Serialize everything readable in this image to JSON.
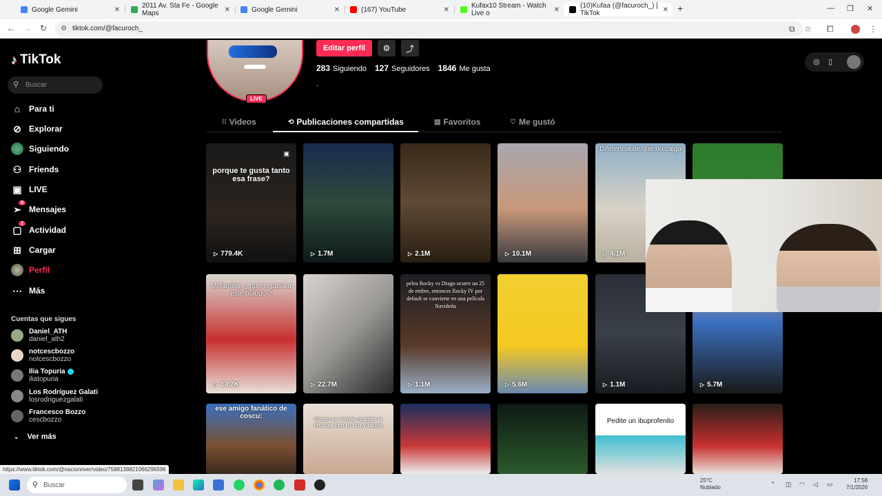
{
  "browser": {
    "tabs": [
      {
        "title": "Google Gemini",
        "color": "#4285f4"
      },
      {
        "title": "2011 Av. Sta Fe - Google Maps",
        "color": "#34a853"
      },
      {
        "title": "Google Gemini",
        "color": "#4285f4"
      },
      {
        "title": "(167) YouTube",
        "color": "#ff0000"
      },
      {
        "title": "Kufax10 Stream - Watch Live o",
        "color": "#53fc18"
      },
      {
        "title": "(10)Kufaa (@facuroch_) | TikTok",
        "color": "#000000"
      }
    ],
    "new_tab": "+",
    "url": "tiktok.com/@facuroch_"
  },
  "sidebar": {
    "logo": "TikTok",
    "search_placeholder": "Buscar",
    "nav": [
      {
        "label": "Para ti",
        "icon": "home-icon"
      },
      {
        "label": "Explorar",
        "icon": "compass-icon"
      },
      {
        "label": "Siguiendo",
        "icon": "following-icon"
      },
      {
        "label": "Friends",
        "icon": "friends-icon"
      },
      {
        "label": "LIVE",
        "icon": "live-icon"
      },
      {
        "label": "Mensajes",
        "icon": "messages-icon",
        "badge": "8"
      },
      {
        "label": "Actividad",
        "icon": "activity-icon",
        "badge": "2"
      },
      {
        "label": "Cargar",
        "icon": "upload-icon"
      },
      {
        "label": "Perfil",
        "icon": "profile-icon"
      },
      {
        "label": "Más",
        "icon": "more-icon"
      }
    ],
    "following_header": "Cuentas que sigues",
    "accounts": [
      {
        "name": "Daniel_ATH",
        "handle": "daniel_ath2"
      },
      {
        "name": "notcescbozzo",
        "handle": "notcescbozzo"
      },
      {
        "name": "Ilia Topuria",
        "handle": "iliatopuria",
        "verified": true
      },
      {
        "name": "Los Rodríguez Galati",
        "handle": "losrodriguezgalati"
      },
      {
        "name": "Francesco Bozzo",
        "handle": "cescbozzo"
      }
    ],
    "see_more": "Ver más"
  },
  "profile": {
    "live_badge": "LIVE",
    "edit_button": "Editar perfil",
    "following_count": "283",
    "following_label": "Siguiendo",
    "followers_count": "127",
    "followers_label": "Seguidores",
    "likes_count": "1846",
    "likes_label": "Me gusta",
    "bio": "."
  },
  "tabs": {
    "videos": "Videos",
    "reposts": "Publicaciones compartidas",
    "favorites": "Favoritos",
    "liked": "Me gustó"
  },
  "grid": [
    {
      "views": "779.4K",
      "caption": "porque te gusta tanto esa frase?"
    },
    {
      "views": "1.7M",
      "caption": ""
    },
    {
      "views": "2.1M",
      "caption": ""
    },
    {
      "views": "10.1M",
      "caption": ""
    },
    {
      "views": "4.1M",
      "caption": "Diferencia de que no caiga"
    },
    {
      "views": "",
      "caption": ""
    },
    {
      "views": "14.7K",
      "caption": "Mi familia: ¿ que le pasa a este boludo ?"
    },
    {
      "views": "22.7M",
      "caption": ""
    },
    {
      "views": "1.1M",
      "caption": "pelea Rocky vs Drago ocurre un 25 de embre, entonces Rocky IV por default se convierte en una película Navideña"
    },
    {
      "views": "5.6M",
      "caption": ""
    },
    {
      "views": "1.1M",
      "caption": ""
    },
    {
      "views": "5.7M",
      "caption": ""
    },
    {
      "views": "",
      "caption": "ese amigo fanático de coscu:"
    },
    {
      "views": "",
      "caption": "Como se siente cuando la chocas con tu bro y bruna"
    },
    {
      "views": "",
      "caption": ""
    },
    {
      "views": "",
      "caption": ""
    },
    {
      "views": "",
      "caption": "Pedite un ibuprofenito"
    },
    {
      "views": "",
      "caption": ""
    }
  ],
  "status_url": "https://www.tiktok.com/@nacionriver/video/7588138821066296596",
  "taskbar": {
    "search": "Buscar",
    "weather_temp": "25°C",
    "weather_desc": "Nublado",
    "time": "17:58",
    "date": "7/1/2026"
  }
}
